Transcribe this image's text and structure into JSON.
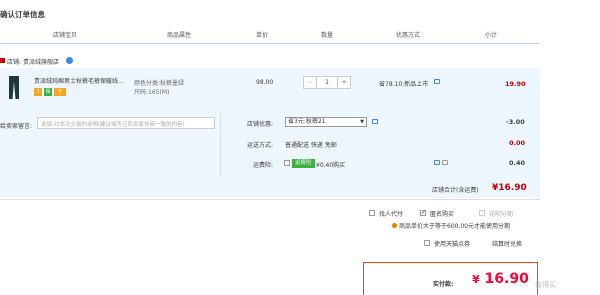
{
  "page": {
    "title": "确认订单信息"
  },
  "columns": [
    "店铺宝贝",
    "商品属性",
    "单价",
    "数量",
    "优惠方式",
    "小计"
  ],
  "shop": {
    "label": "店铺:",
    "name": "贵派绒旗舰店"
  },
  "item": {
    "title": "贵派绒纯棉男士秋裤毛裤保暖线...",
    "tags": [
      "7",
      "保",
      "卡"
    ],
    "attr_color": "颜色分类:秋裤墨绿",
    "attr_size": "尺码:165(M)",
    "price": "98.00",
    "qty_minus": "-",
    "qty_value": "1",
    "qty_plus": "+",
    "promo": "省78.10:新品上市",
    "subtotal": "19.90"
  },
  "message": {
    "label": "给卖家留言:",
    "placeholder": "选填:对本次交易的说明(建议填写已和卖家协商一致的内容)"
  },
  "coupon": {
    "label": "店铺优惠:",
    "selected": "省3元:秋裤21",
    "value": "-3.00"
  },
  "shipping": {
    "label": "运送方式:",
    "text": "普通配送 快递 免邮",
    "value": "0.00"
  },
  "insurance": {
    "label": "运费险:",
    "badge": "运费险",
    "text": "¥0.40购买",
    "value": "0.40"
  },
  "shop_total": {
    "label": "店铺合计(含运费)",
    "value": "¥16.90"
  },
  "options": {
    "proxy": "找人代付",
    "anonymous": "匿名购买",
    "installment": "花呗分期",
    "installment_note": "商品单价大于等于600.00元才能使用分期",
    "tmall_points": "使用天猫点券",
    "settle": "结算时兑换"
  },
  "payment": {
    "label": "实付款:",
    "currency": "¥",
    "value": "16.90"
  },
  "watermark": "值得买"
}
